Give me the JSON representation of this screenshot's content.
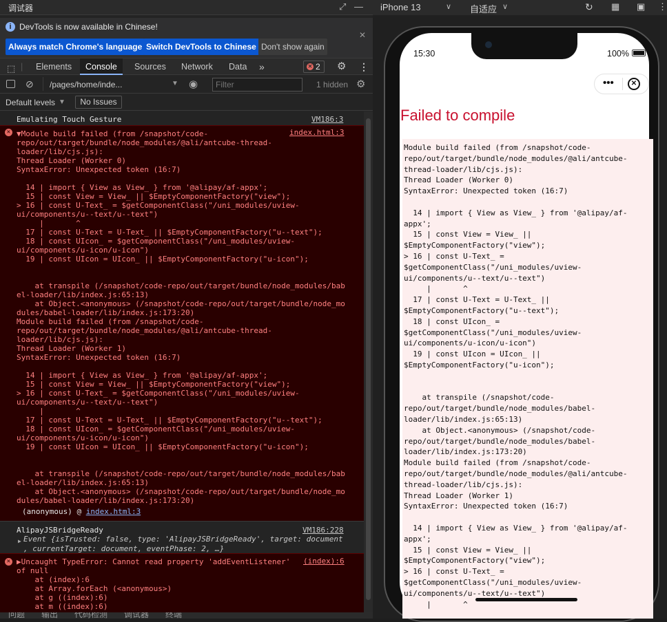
{
  "window": {
    "title": "调试器"
  },
  "infobar": {
    "message": "DevTools is now available in Chinese!",
    "btn_match": "Always match Chrome's language",
    "btn_switch": "Switch DevTools to Chinese",
    "btn_dont": "Don't show again"
  },
  "tabs": [
    {
      "label": "Elements"
    },
    {
      "label": "Console"
    },
    {
      "label": "Sources"
    },
    {
      "label": "Network"
    },
    {
      "label": "Data"
    }
  ],
  "error_count": "2",
  "filter": {
    "context": "/pages/home/inde...",
    "placeholder": "Filter",
    "hidden": "1 hidden"
  },
  "levels": {
    "label": "Default levels",
    "issues": "No Issues"
  },
  "console": {
    "emulating": {
      "text": "Emulating Touch Gesture",
      "src": "VM186:3"
    },
    "error1": {
      "src": "index.html:3",
      "lines": [
        "▼Module build failed (from /snapshot/code-",
        "repo/out/target/bundle/node_modules/@ali/antcube-thread-",
        "loader/lib/cjs.js):",
        "Thread Loader (Worker 0)",
        "SyntaxError: Unexpected token (16:7)",
        "",
        "  14 | import { View as View_ } from '@alipay/af-appx';",
        "  15 | const View = View_ || $EmptyComponentFactory(\"view\");",
        "> 16 | const U-Text_ = $getComponentClass(\"/uni_modules/uview-",
        "ui/components/u--text/u--text\")",
        "     |       ^",
        "  17 | const U-Text = U-Text_ || $EmptyComponentFactory(\"u--text\");",
        "  18 | const UIcon_ = $getComponentClass(\"/uni_modules/uview-",
        "ui/components/u-icon/u-icon\")",
        "  19 | const UIcon = UIcon_ || $EmptyComponentFactory(\"u-icon\");",
        "",
        "",
        "    at transpile (/snapshot/code-repo/out/target/bundle/node_modules/bab",
        "el-loader/lib/index.js:65:13)",
        "    at Object.<anonymous> (/snapshot/code-repo/out/target/bundle/node_mo",
        "dules/babel-loader/lib/index.js:173:20)",
        "Module build failed (from /snapshot/code-",
        "repo/out/target/bundle/node_modules/@ali/antcube-thread-",
        "loader/lib/cjs.js):",
        "Thread Loader (Worker 1)",
        "SyntaxError: Unexpected token (16:7)",
        "",
        "  14 | import { View as View_ } from '@alipay/af-appx';",
        "  15 | const View = View_ || $EmptyComponentFactory(\"view\");",
        "> 16 | const U-Text_ = $getComponentClass(\"/uni_modules/uview-",
        "ui/components/u--text/u--text\")",
        "     |       ^",
        "  17 | const U-Text = U-Text_ || $EmptyComponentFactory(\"u--text\");",
        "  18 | const UIcon_ = $getComponentClass(\"/uni_modules/uview-",
        "ui/components/u-icon/u-icon\")",
        "  19 | const UIcon = UIcon_ || $EmptyComponentFactory(\"u-icon\");",
        "",
        "",
        "    at transpile (/snapshot/code-repo/out/target/bundle/node_modules/bab",
        "el-loader/lib/index.js:65:13)",
        "    at Object.<anonymous> (/snapshot/code-repo/out/target/bundle/node_mo",
        "dules/babel-loader/lib/index.js:173:20)"
      ],
      "anon": "(anonymous) @ ",
      "anon_link": "index.html:3"
    },
    "bridge": {
      "text": "AlipayJSBridgeReady",
      "src": "VM186:228",
      "event_line1": "Event {isTrusted: false, type: 'AlipayJSBridgeReady', target: document",
      "event_line2": ", currentTarget: document, eventPhase: 2, …}"
    },
    "error2": {
      "src": "(index):6",
      "lines": [
        "▶Uncaught TypeError: Cannot read property 'addEventListener'",
        "of null",
        "    at (index):6",
        "    at Array.forEach (<anonymous>)",
        "    at g ((index):6)",
        "    at m ((index):6)"
      ]
    }
  },
  "sim": {
    "device": "iPhone 13",
    "zoom": "自适应",
    "time": "15:30",
    "battery": "100%",
    "error_title": "Failed to compile",
    "error_lines": [
      "Module build failed (from /snapshot/code-",
      "repo/out/target/bundle/node_modules/@ali/antcube-",
      "thread-loader/lib/cjs.js):",
      "Thread Loader (Worker 0)",
      "SyntaxError: Unexpected token (16:7)",
      "",
      "  14 | import { View as View_ } from '@alipay/af-",
      "appx';",
      "  15 | const View = View_ ||",
      "$EmptyComponentFactory(\"view\");",
      "> 16 | const U-Text_ =",
      "$getComponentClass(\"/uni_modules/uview-",
      "ui/components/u--text/u--text\")",
      "     |       ^",
      "  17 | const U-Text = U-Text_ ||",
      "$EmptyComponentFactory(\"u--text\");",
      "  18 | const UIcon_ =",
      "$getComponentClass(\"/uni_modules/uview-",
      "ui/components/u-icon/u-icon\")",
      "  19 | const UIcon = UIcon_ ||",
      "$EmptyComponentFactory(\"u-icon\");",
      "",
      "",
      "    at transpile (/snapshot/code-",
      "repo/out/target/bundle/node_modules/babel-",
      "loader/lib/index.js:65:13)",
      "    at Object.<anonymous> (/snapshot/code-",
      "repo/out/target/bundle/node_modules/babel-",
      "loader/lib/index.js:173:20)",
      "Module build failed (from /snapshot/code-",
      "repo/out/target/bundle/node_modules/@ali/antcube-",
      "thread-loader/lib/cjs.js):",
      "Thread Loader (Worker 1)",
      "SyntaxError: Unexpected token (16:7)",
      "",
      "  14 | import { View as View_ } from '@alipay/af-",
      "appx';",
      "  15 | const View = View_ ||",
      "$EmptyComponentFactory(\"view\");",
      "> 16 | const U-Text_ =",
      "$getComponentClass(\"/uni_modules/uview-",
      "ui/components/u--text/u--text\")",
      "     |       ^"
    ]
  },
  "bottom_tabs": [
    "问题",
    "输出",
    "代码检测",
    "调试器",
    "终端"
  ]
}
